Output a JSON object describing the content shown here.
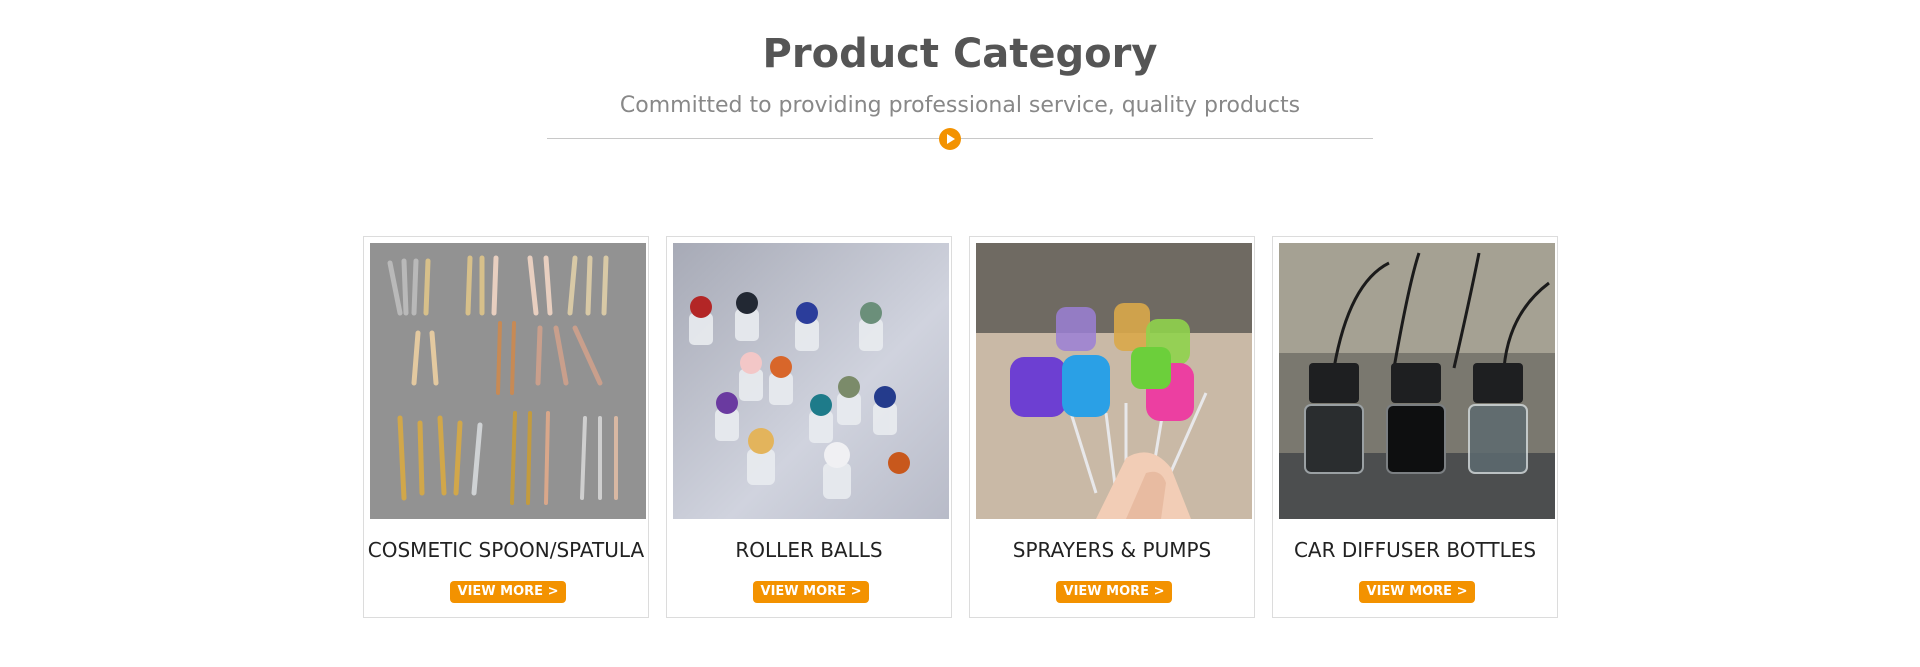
{
  "section": {
    "title": "Product Category",
    "subtitle": "Committed to providing professional service, quality products",
    "divider_icon": "play-circle-icon"
  },
  "colors": {
    "accent": "#f39200",
    "title": "#555555",
    "subtitle": "#888888"
  },
  "products": [
    {
      "title": "COSMETIC SPOON/SPATULA",
      "button": "VIEW MORE >",
      "image": "cosmetic-spoons-photo"
    },
    {
      "title": "ROLLER BALLS",
      "button": "VIEW MORE >",
      "image": "roller-balls-photo"
    },
    {
      "title": "SPRAYERS & PUMPS",
      "button": "VIEW MORE >",
      "image": "sprayer-pumps-photo"
    },
    {
      "title": "CAR DIFFUSER BOTTLES",
      "button": "VIEW MORE >",
      "image": "car-diffuser-bottles-photo"
    }
  ]
}
